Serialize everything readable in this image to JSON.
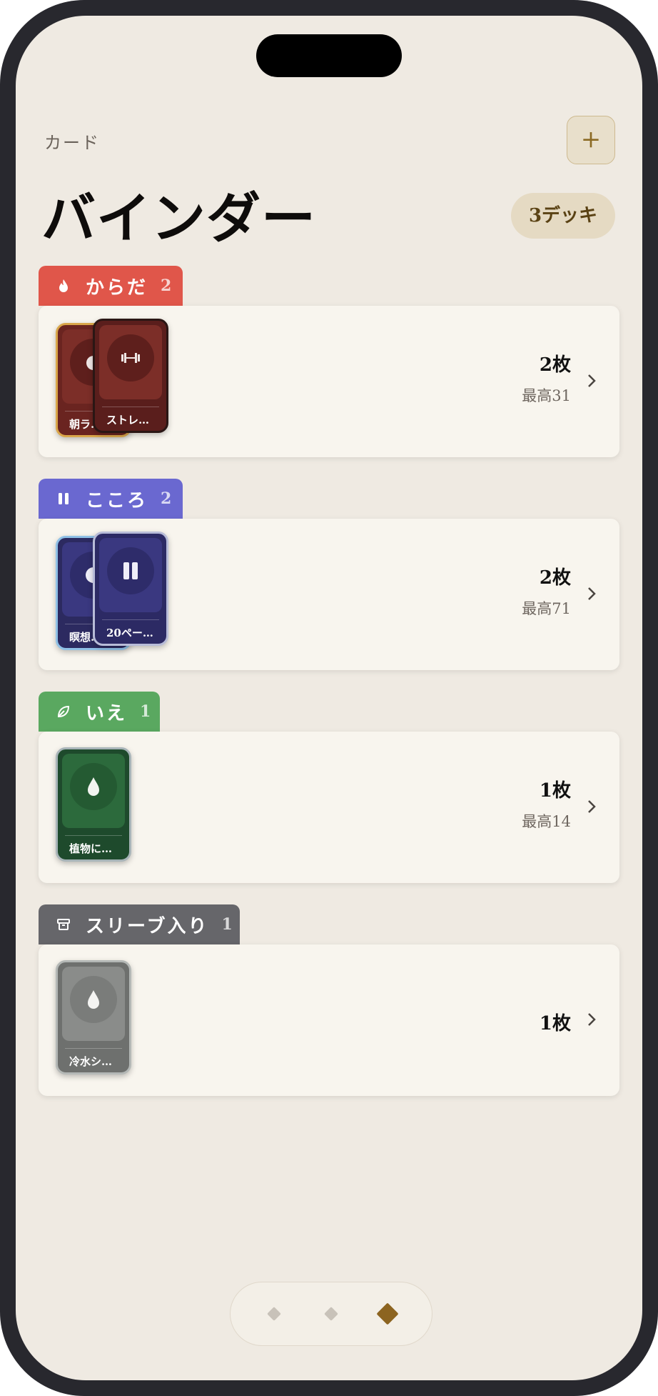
{
  "header": {
    "eyebrow": "カード",
    "title": "バインダー",
    "deck_count": "3デッキ",
    "add_label": "+"
  },
  "sections": [
    {
      "name": "からだ",
      "count": "2",
      "color": "#e0564a",
      "icon": "flame-icon",
      "cards": [
        {
          "label": "朝ラ…",
          "icon": "flame-icon"
        },
        {
          "label": "ストレ…",
          "icon": "dumbbell-icon"
        }
      ],
      "total": "2枚",
      "best": "最高31"
    },
    {
      "name": "こころ",
      "count": "2",
      "color": "#6a68d0",
      "icon": "pause-icon",
      "cards": [
        {
          "label": "瞑想…",
          "icon": "moon-icon"
        },
        {
          "label": "20ペー…",
          "icon": "pause-icon"
        }
      ],
      "total": "2枚",
      "best": "最高71"
    },
    {
      "name": "いえ",
      "count": "1",
      "color": "#5aa860",
      "icon": "leaf-icon",
      "cards": [
        {
          "label": "植物に…",
          "icon": "drop-icon"
        }
      ],
      "total": "1枚",
      "best": "最高14"
    },
    {
      "name": "スリーブ入り",
      "count": "1",
      "color": "#66666a",
      "icon": "archive-icon",
      "cards": [
        {
          "label": "冷水シ…",
          "icon": "drop-icon"
        }
      ],
      "total": "1枚",
      "best": ""
    }
  ],
  "nav": {
    "items": [
      "nav-diamond-1",
      "nav-diamond-2",
      "nav-diamond-3"
    ],
    "active": 2
  },
  "colors": {
    "accent": "#8c6420",
    "background": "#efeae2",
    "panel": "#f8f5ee"
  }
}
